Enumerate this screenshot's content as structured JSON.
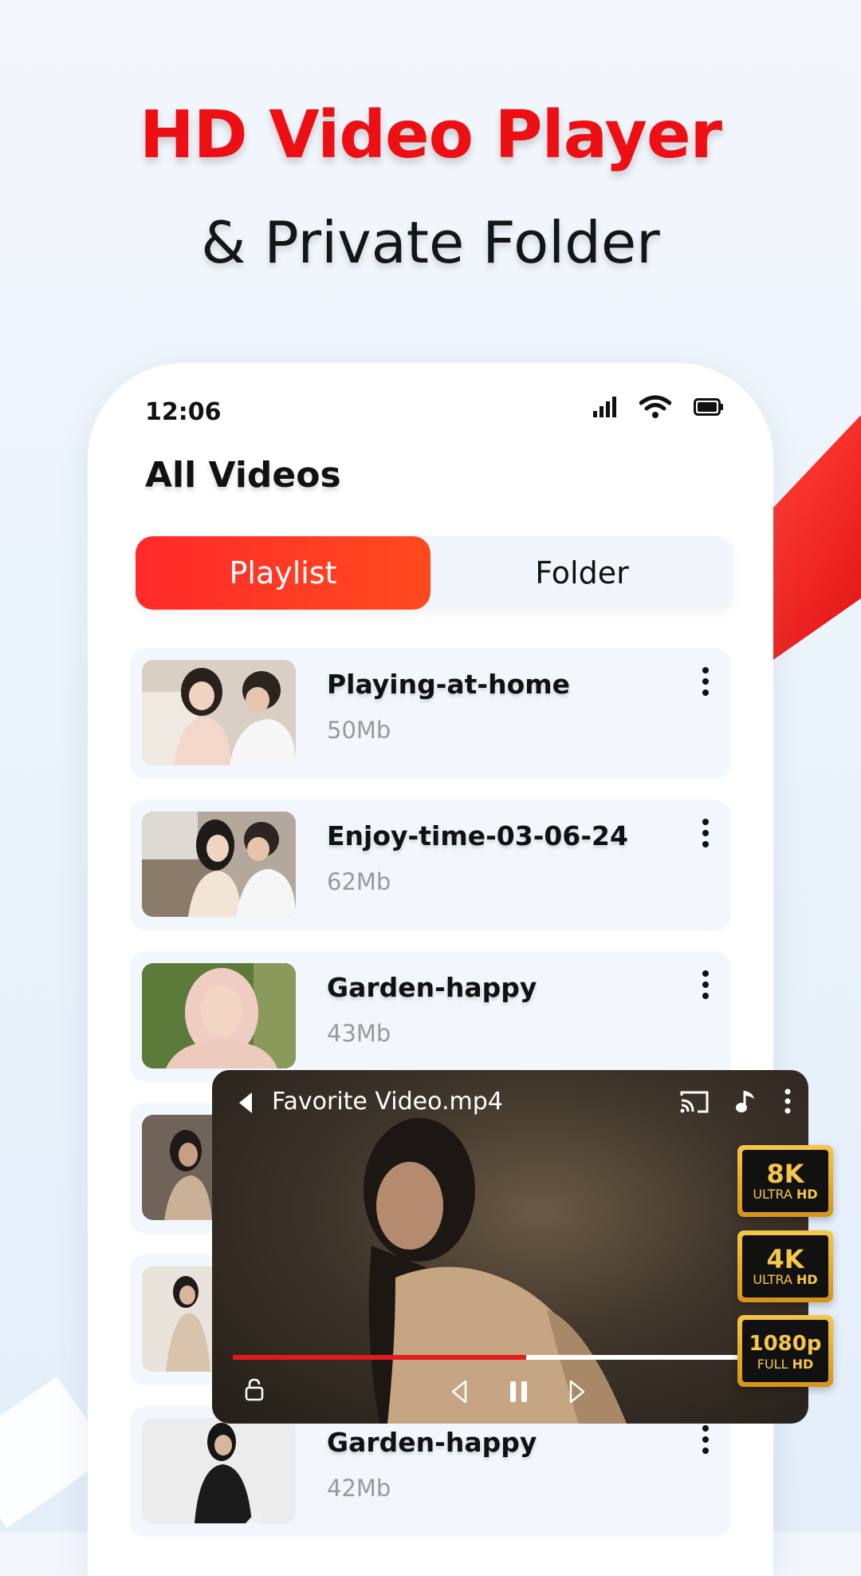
{
  "header": {
    "title": "HD Video Player",
    "subtitle": "& Private Folder"
  },
  "status_bar": {
    "time": "12:06",
    "icons": [
      "signal-icon",
      "wifi-icon",
      "battery-icon"
    ]
  },
  "screen": {
    "title": "All Videos"
  },
  "tabs": [
    {
      "label": "Playlist",
      "active": true
    },
    {
      "label": "Folder",
      "active": false
    }
  ],
  "videos": [
    {
      "name": "Playing-at-home",
      "size": "50Mb"
    },
    {
      "name": "Enjoy-time-03-06-24",
      "size": "62Mb"
    },
    {
      "name": "Garden-happy",
      "size": "43Mb"
    },
    {
      "name": "",
      "size": ""
    },
    {
      "name": "",
      "size": ""
    },
    {
      "name": "Garden-happy",
      "size": "42Mb"
    }
  ],
  "player": {
    "title": "Favorite Video.mp4",
    "progress": 0.51,
    "icons": [
      "back-icon",
      "cast-icon",
      "music-icon",
      "more-icon",
      "lock-icon",
      "previous-icon",
      "pause-icon",
      "next-icon"
    ]
  },
  "badges": [
    {
      "big": "8K",
      "small": "ULTRA",
      "strong": "HD"
    },
    {
      "big": "4K",
      "small": "ULTRA",
      "strong": "HD"
    },
    {
      "big": "1080p",
      "small": "FULL",
      "strong": "HD"
    }
  ],
  "colors": {
    "accent": "#ee0f15",
    "tab_gradient_start": "#ff2a2a",
    "tab_gradient_end": "#ff4a1e",
    "badge_gold": "#f5c64a"
  }
}
